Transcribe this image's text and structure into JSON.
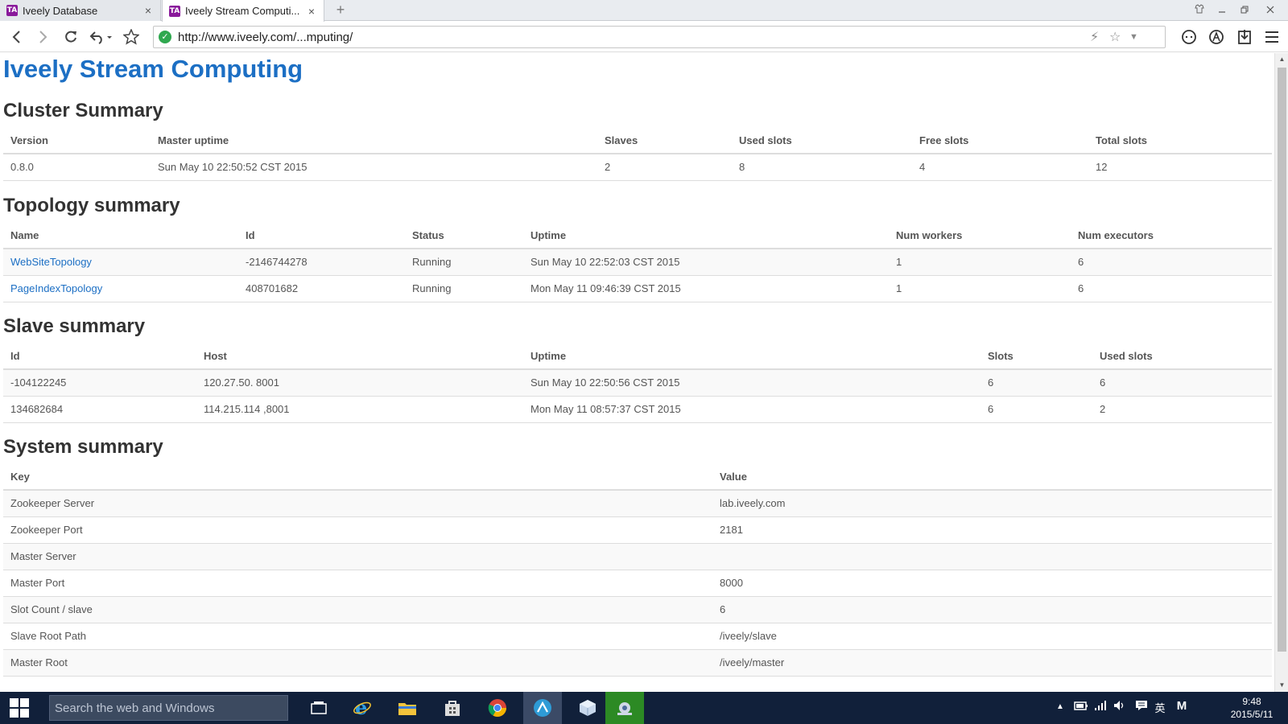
{
  "browser": {
    "tabs": [
      {
        "label": "Iveely Database",
        "favicon": "iveely-logo-icon",
        "close": "×"
      },
      {
        "label": "Iveely Stream Computi...",
        "favicon": "iveely-logo-icon",
        "close": "×"
      }
    ],
    "new_tab": "+",
    "url": "http://www.iveely.com/...mputing/"
  },
  "page": {
    "title": "Iveely Stream Computing",
    "cluster": {
      "title": "Cluster Summary",
      "headers": [
        "Version",
        "Master uptime",
        "Slaves",
        "Used slots",
        "Free slots",
        "Total slots"
      ],
      "rows": [
        [
          "0.8.0",
          "Sun May 10 22:50:52 CST 2015",
          "2",
          "8",
          "4",
          "12"
        ]
      ]
    },
    "topology": {
      "title": "Topology summary",
      "headers": [
        "Name",
        "Id",
        "Status",
        "Uptime",
        "Num workers",
        "Num executors"
      ],
      "rows": [
        [
          "WebSiteTopology",
          "-2146744278",
          "Running",
          "Sun May 10 22:52:03 CST 2015",
          "1",
          "6"
        ],
        [
          "PageIndexTopology",
          "408701682",
          "Running",
          "Mon May 11 09:46:39 CST 2015",
          "1",
          "6"
        ]
      ]
    },
    "slave": {
      "title": "Slave summary",
      "headers": [
        "Id",
        "Host",
        "Uptime",
        "Slots",
        "Used slots"
      ],
      "rows": [
        [
          "-104122245",
          "120.27.50.  8001",
          "Sun May 10 22:50:56 CST 2015",
          "6",
          "6"
        ],
        [
          "134682684",
          "114.215.114  ,8001",
          "Mon May 11 08:57:37 CST 2015",
          "6",
          "2"
        ]
      ]
    },
    "system": {
      "title": "System summary",
      "headers": [
        "Key",
        "Value"
      ],
      "rows": [
        [
          "Zookeeper Server",
          "lab.iveely.com"
        ],
        [
          "Zookeeper Port",
          "2181"
        ],
        [
          "Master Server",
          ""
        ],
        [
          "Master Port",
          "8000"
        ],
        [
          "Slot Count / slave",
          "6"
        ],
        [
          "Slave Root Path",
          "/iveely/slave"
        ],
        [
          "Master Root",
          "/iveely/master"
        ]
      ]
    }
  },
  "taskbar": {
    "search_placeholder": "Search the web and Windows",
    "ime": "英",
    "ime2": "M",
    "time": "9:48",
    "date": "2015/5/11"
  },
  "colors": {
    "link": "#1c6fc4",
    "taskbar": "#11203a"
  }
}
